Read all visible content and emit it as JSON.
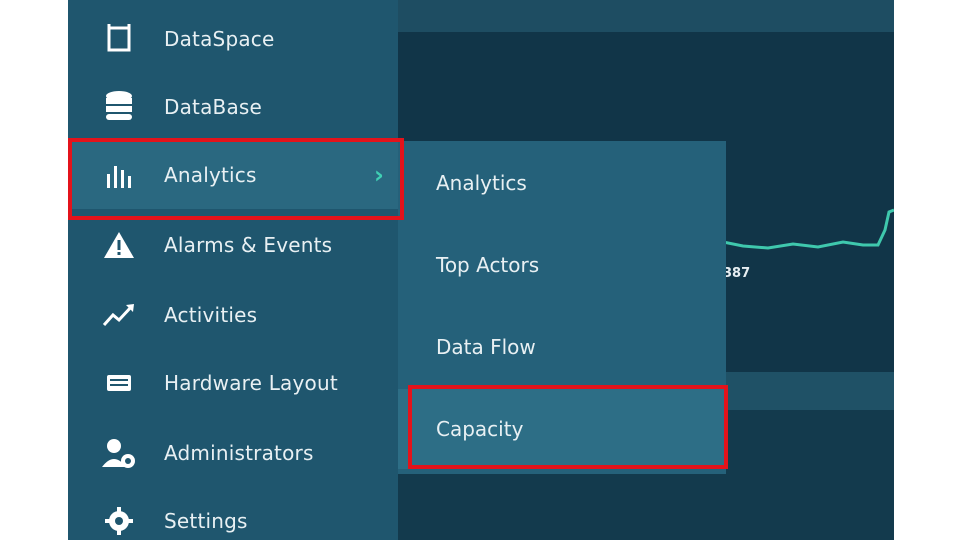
{
  "colors": {
    "sidebar_bg": "#1f566e",
    "submenu_bg": "#25617a",
    "accent": "#3fd0b4",
    "highlight": "#e3131b"
  },
  "sidebar": {
    "items": [
      {
        "label": "DataSpace",
        "icon": "dataspace-icon"
      },
      {
        "label": "DataBase",
        "icon": "database-icon"
      },
      {
        "label": "Analytics",
        "icon": "bar-chart-icon",
        "active": true
      },
      {
        "label": "Alarms & Events",
        "icon": "warning-icon"
      },
      {
        "label": "Activities",
        "icon": "activity-line-icon"
      },
      {
        "label": "Hardware Layout",
        "icon": "hardware-icon"
      },
      {
        "label": "Administrators",
        "icon": "admin-user-icon"
      },
      {
        "label": "Settings",
        "icon": "gear-icon"
      }
    ]
  },
  "submenu": {
    "items": [
      {
        "label": "Analytics"
      },
      {
        "label": "Top Actors"
      },
      {
        "label": "Data Flow"
      },
      {
        "label": "Capacity",
        "highlighted": true
      }
    ]
  },
  "background": {
    "chart_tick": "387"
  }
}
